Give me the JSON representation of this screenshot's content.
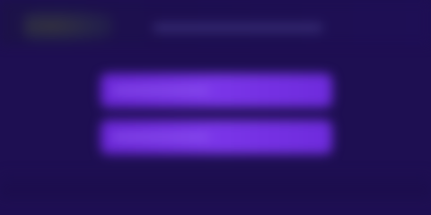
{
  "screen": {
    "state": "blurred",
    "background_color": "#1e0f52",
    "accent_color": "#7a35e8"
  },
  "header": {
    "logo_icon": "app-logo-icon",
    "title": ""
  },
  "options": [
    {
      "label": ""
    },
    {
      "label": ""
    }
  ]
}
